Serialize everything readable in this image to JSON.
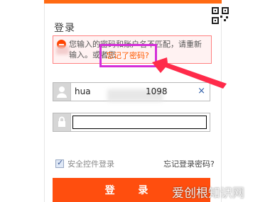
{
  "login": {
    "title": "登录",
    "error": {
      "message": "您输入的密码和账户名不匹配，请重新输入。或者您",
      "forgot_link": "忘记了密码?"
    },
    "username": {
      "value": "hua",
      "value_suffix": "1098",
      "clear_label": "×"
    },
    "password": {
      "value": ""
    },
    "secure_control": {
      "label": "安全控件登录",
      "checked": true
    },
    "forgot_password": "忘记登录密码?",
    "submit_label": "登 录"
  },
  "watermark": "爱创根知识网",
  "colors": {
    "accent": "#ff6a13",
    "button": "#ff4e0e",
    "error_border": "#ff8080",
    "highlight": "#d42ed8",
    "arrow": "#ff2b4a"
  }
}
